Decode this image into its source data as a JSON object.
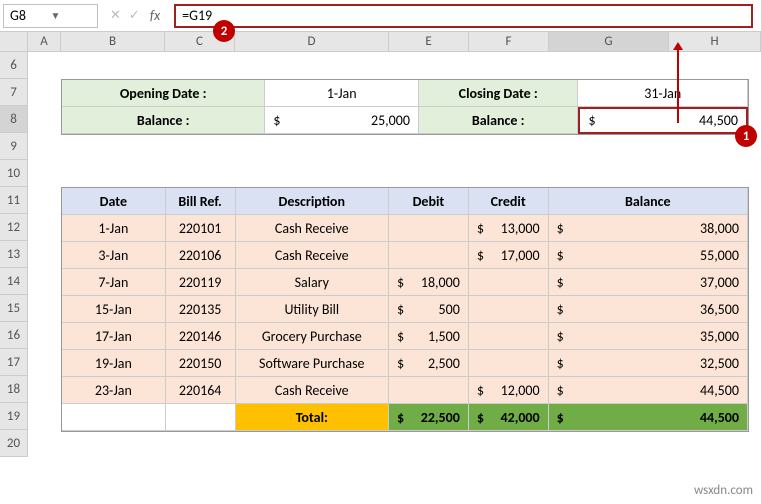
{
  "namebox": "G8",
  "formula": "=G19",
  "callout1": "1",
  "callout2": "2",
  "columns": [
    "A",
    "B",
    "C",
    "D",
    "E",
    "F",
    "G",
    "H"
  ],
  "rows": [
    "6",
    "7",
    "8",
    "9",
    "10",
    "11",
    "12",
    "13",
    "14",
    "15",
    "16",
    "17",
    "18",
    "19",
    "20"
  ],
  "summary": {
    "openingLabel": "Opening Date :",
    "openingDate": "1-Jan",
    "closingLabel": "Closing Date :",
    "closingDate": "31-Jan",
    "balanceLabel1": "Balance :",
    "balanceCur1": "$",
    "balance1": "25,000",
    "balanceLabel2": "Balance :",
    "balanceCur2": "$",
    "balance2": "44,500"
  },
  "tableHeaders": {
    "date": "Date",
    "bill": "Bill Ref.",
    "desc": "Description",
    "debit": "Debit",
    "credit": "Credit",
    "balance": "Balance"
  },
  "tableRows": [
    {
      "date": "1-Jan",
      "bill": "220101",
      "desc": "Cash Receive",
      "debit": "",
      "credit": "13,000",
      "balance": "38,000"
    },
    {
      "date": "3-Jan",
      "bill": "220106",
      "desc": "Cash Receive",
      "debit": "",
      "credit": "17,000",
      "balance": "55,000"
    },
    {
      "date": "7-Jan",
      "bill": "220119",
      "desc": "Salary",
      "debit": "18,000",
      "credit": "",
      "balance": "37,000"
    },
    {
      "date": "15-Jan",
      "bill": "220135",
      "desc": "Utility Bill",
      "debit": "500",
      "credit": "",
      "balance": "36,500"
    },
    {
      "date": "17-Jan",
      "bill": "220146",
      "desc": "Grocery Purchase",
      "debit": "1,500",
      "credit": "",
      "balance": "35,000"
    },
    {
      "date": "19-Jan",
      "bill": "220150",
      "desc": "Software Purchase",
      "debit": "2,500",
      "credit": "",
      "balance": "32,500"
    },
    {
      "date": "23-Jan",
      "bill": "220164",
      "desc": "Cash Receive",
      "debit": "",
      "credit": "12,000",
      "balance": "44,500"
    }
  ],
  "totals": {
    "label": "Total:",
    "debit": "22,500",
    "credit": "42,000",
    "balance": "44,500"
  },
  "currency": "$",
  "watermark": "wsxdn.com"
}
